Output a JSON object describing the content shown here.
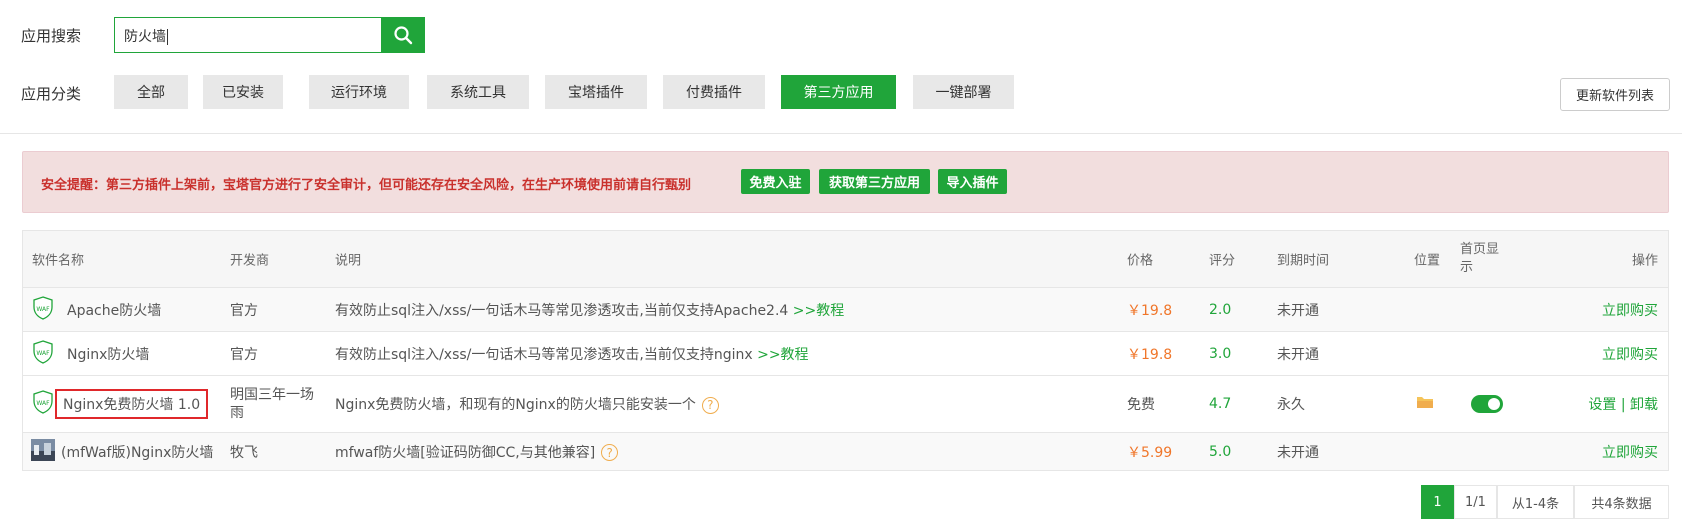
{
  "search": {
    "label": "应用搜索",
    "value": "防火墙"
  },
  "categories": {
    "label": "应用分类",
    "items": [
      "全部",
      "已安装",
      "运行环境",
      "系统工具",
      "宝塔插件",
      "付费插件",
      "第三方应用",
      "一键部署"
    ],
    "active_index": 6
  },
  "refresh_label": "更新软件列表",
  "alert": {
    "text": "安全提醒：第三方插件上架前，宝塔官方进行了安全审计，但可能还存在安全风险，在生产环境使用前请自行甄别",
    "buttons": [
      "免费入驻",
      "获取第三方应用",
      "导入插件"
    ]
  },
  "table": {
    "headers": {
      "name": "软件名称",
      "developer": "开发商",
      "desc": "说明",
      "price": "价格",
      "rating": "评分",
      "expiry": "到期时间",
      "location": "位置",
      "homepage": "首页显示",
      "action": "操作"
    },
    "rows": [
      {
        "name": "Apache防火墙",
        "developer": "官方",
        "desc": "有效防止sql注入/xss/一句话木马等常见渗透攻击,当前仅支持Apache2.4",
        "tutorial": ">>教程",
        "price": "￥19.8",
        "rating": "2.0",
        "expiry": "未开通",
        "action": "立即购买"
      },
      {
        "name": "Nginx防火墙",
        "developer": "官方",
        "desc": "有效防止sql注入/xss/一句话木马等常见渗透攻击,当前仅支持nginx",
        "tutorial": ">>教程",
        "price": "￥19.8",
        "rating": "3.0",
        "expiry": "未开通",
        "action": "立即购买"
      },
      {
        "name": "Nginx免费防火墙 1.0",
        "developer": "明国三年一场雨",
        "desc": "Nginx免费防火墙，和现有的Nginx的防火墙只能安装一个",
        "help": "?",
        "price": "免费",
        "rating": "4.7",
        "expiry": "永久",
        "action_settings": "设置",
        "action_sep": "|",
        "action_uninstall": "卸载",
        "homepage_toggle": true
      },
      {
        "name": "(mfWaf版)Nginx防火墙",
        "developer": "牧飞",
        "desc": "mfwaf防火墙[验证码防御CC,与其他兼容]",
        "help": "?",
        "price": "￥5.99",
        "rating": "5.0",
        "expiry": "未开通",
        "action": "立即购买"
      }
    ]
  },
  "pagination": {
    "current": "1",
    "pages": "1/1",
    "range": "从1-4条",
    "total": "共4条数据"
  },
  "colors": {
    "accent": "#20a53a",
    "price": "#f0762a",
    "alert_bg": "#f2dede",
    "alert_text": "#c9302c",
    "highlight_box": "#e0282b"
  },
  "icons": {
    "search": "search-icon",
    "waf": "waf-shield-icon",
    "folder": "folder-icon",
    "help": "question-icon",
    "avatar": "mfwaf-image-icon"
  }
}
